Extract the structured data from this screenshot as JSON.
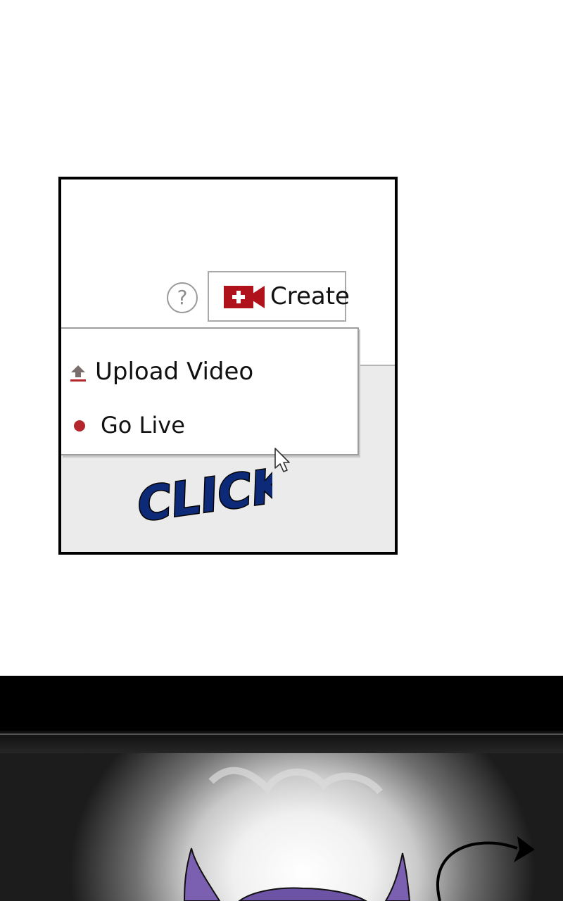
{
  "panel": {
    "help_icon_glyph": "?",
    "create_button": {
      "label": "Create",
      "icon": "camera-plus-icon",
      "icon_color": "#b0121b"
    },
    "dropdown": {
      "items": [
        {
          "label": "Upload Video",
          "icon": "upload-icon",
          "icon_color": "#b4262c"
        },
        {
          "label": "Go Live",
          "icon": "live-dot-icon",
          "icon_color": "#b4262c"
        }
      ]
    },
    "sound_effect": {
      "text": "CLICK",
      "fill_color": "#0d2a78",
      "outline_color": "#000000"
    },
    "cursor_icon": "mouse-pointer-icon"
  },
  "lower_panel": {
    "description_icon": "devil-tail-icon",
    "background_color": "#000000"
  }
}
